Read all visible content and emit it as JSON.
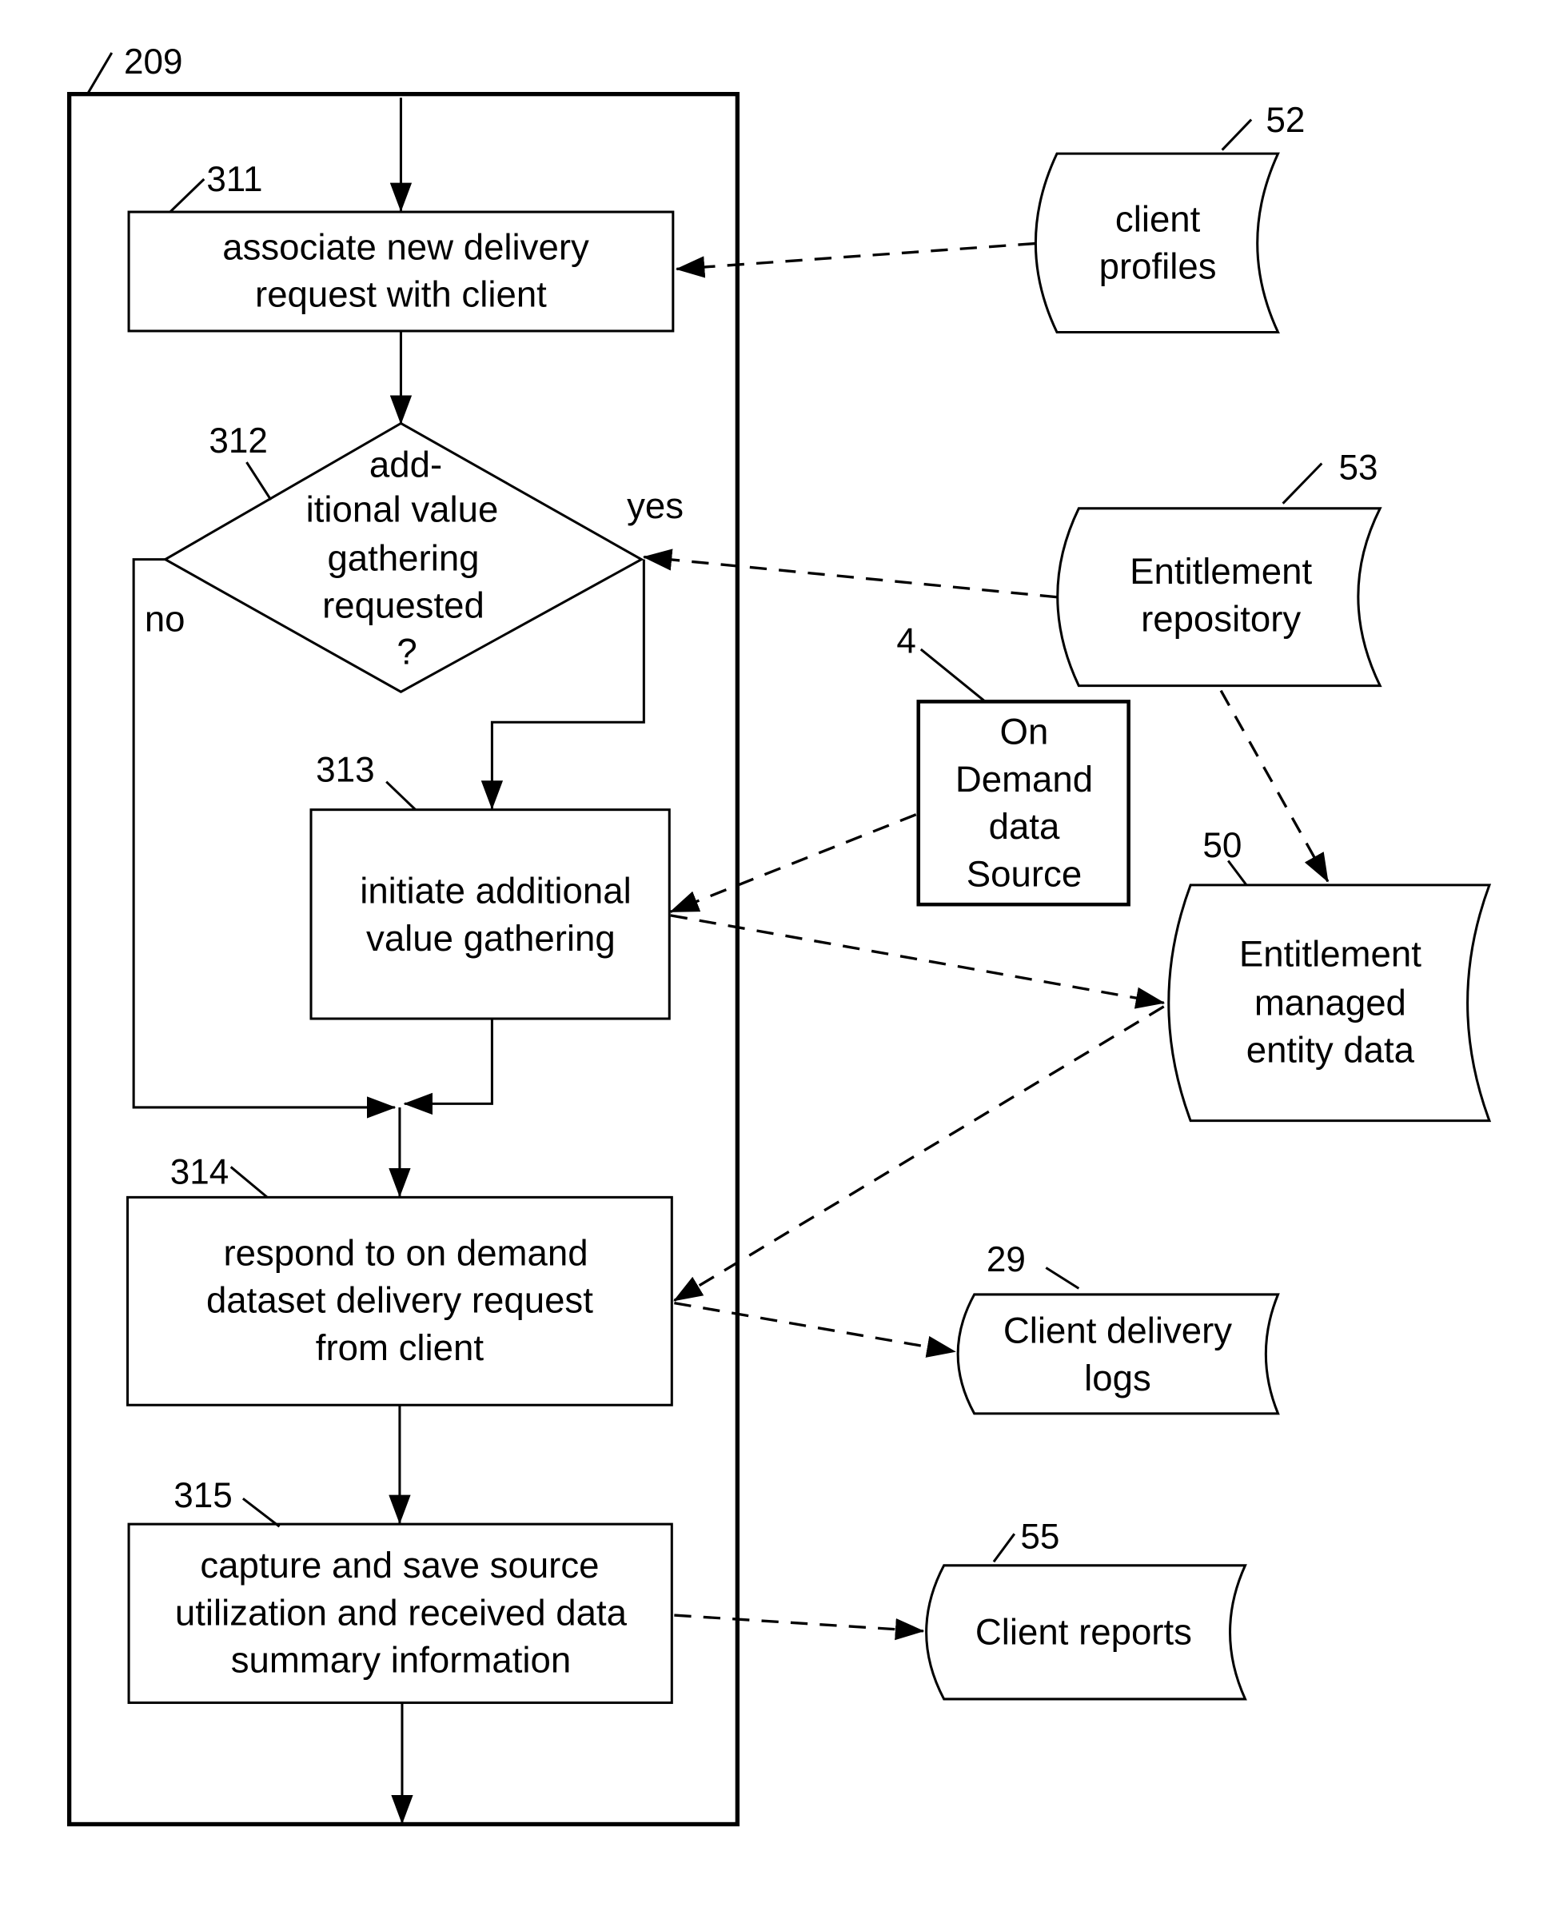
{
  "figure": {
    "frame_ref": "209",
    "steps": [
      {
        "ref": "311",
        "lines": [
          "associate new delivery",
          "request with client"
        ]
      },
      {
        "ref": "312",
        "lines": [
          "add-",
          "itional value",
          "gathering",
          "requested",
          "?"
        ],
        "yes_label": "yes",
        "no_label": "no"
      },
      {
        "ref": "313",
        "lines": [
          "initiate additional",
          "value gathering"
        ]
      },
      {
        "ref": "314",
        "lines": [
          "respond to on demand",
          "dataset delivery request",
          "from client"
        ]
      },
      {
        "ref": "315",
        "lines": [
          "capture and save  source",
          "utilization and received data",
          "summary information"
        ]
      }
    ],
    "stores": [
      {
        "ref": "52",
        "lines": [
          "client",
          "profiles"
        ]
      },
      {
        "ref": "53",
        "lines": [
          "Entitlement",
          "repository"
        ]
      },
      {
        "ref": "50",
        "lines": [
          "Entitlement",
          "managed",
          "entity data"
        ]
      },
      {
        "ref": "29",
        "lines": [
          "Client delivery",
          "logs"
        ]
      },
      {
        "ref": "55",
        "lines": [
          "Client  reports"
        ]
      }
    ],
    "source": {
      "ref": "4",
      "lines": [
        "On",
        "Demand",
        "data",
        "Source"
      ]
    }
  }
}
